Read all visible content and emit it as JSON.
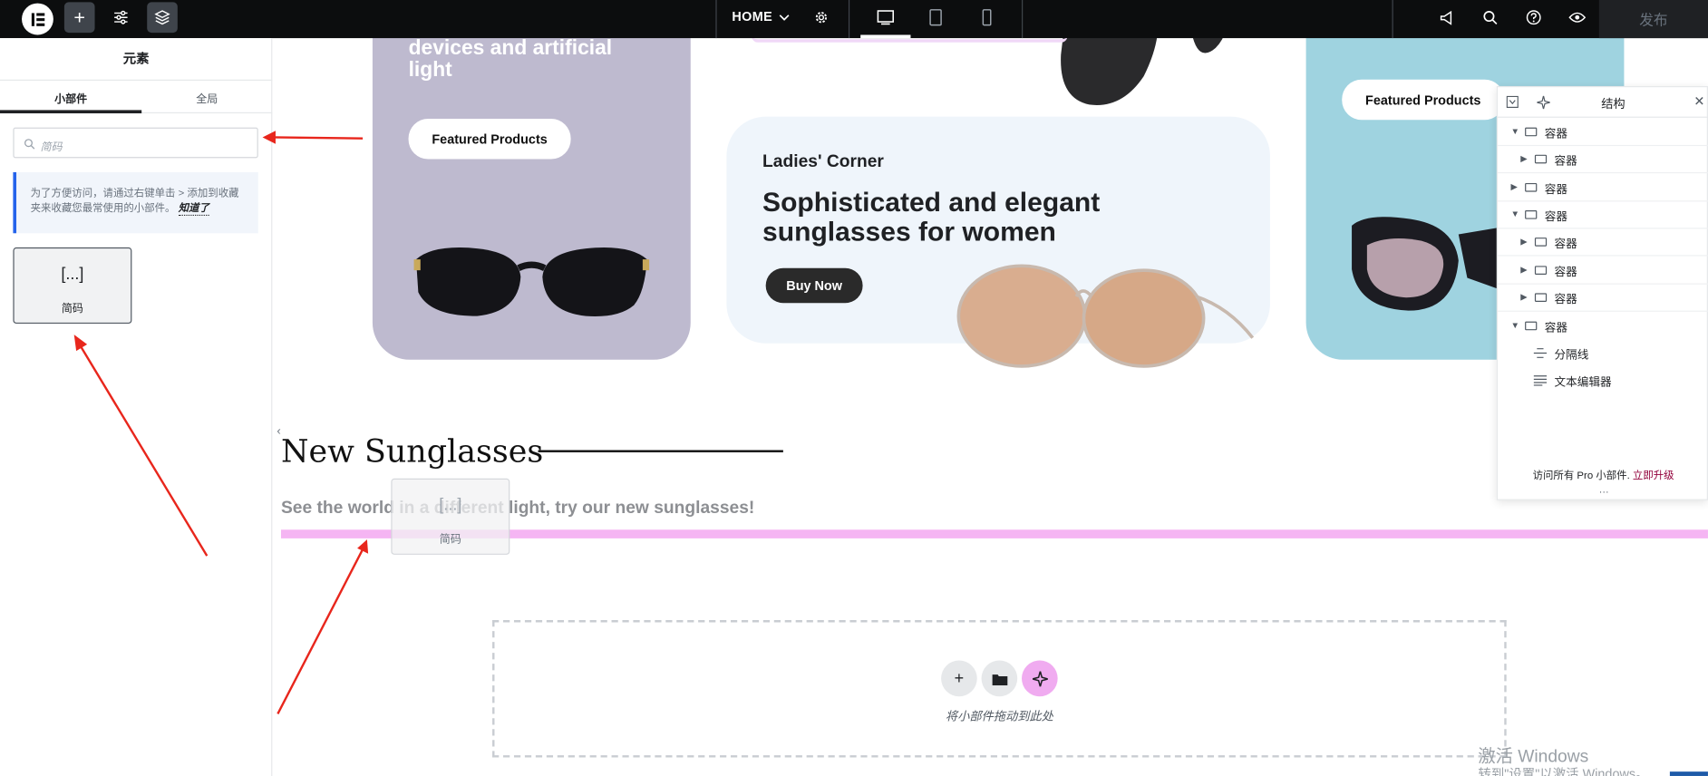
{
  "topbar": {
    "page_label": "HOME",
    "publish_label": "发布"
  },
  "panel": {
    "title": "元素",
    "tab_widgets": "小部件",
    "tab_global": "全局",
    "search_placeholder": "简码",
    "notice_text": "为了方便访问，请通过右键单击 > 添加到收藏夹来收藏您最常使用的小部件。",
    "notice_link": "知道了",
    "widget_icon": "[...]",
    "widget_label": "简码"
  },
  "canvas": {
    "card_left_text": "devices and artificial light",
    "card_left_button": "Featured Products",
    "card_mid_kicker": "Ladies' Corner",
    "card_mid_heading": "Sophisticated and elegant sunglasses for women",
    "card_mid_button": "Buy Now",
    "card_right_button": "Featured Products",
    "new_title": "New Sunglasses",
    "new_subtitle": "See the world in a different light, try our new sunglasses!",
    "ghost_icon": "[...]",
    "ghost_label": "简码",
    "dropzone_text": "将小部件拖动到此处"
  },
  "structure": {
    "title": "结构",
    "rows": [
      {
        "label": "容器"
      },
      {
        "label": "容器"
      },
      {
        "label": "容器"
      },
      {
        "label": "容器"
      },
      {
        "label": "容器"
      },
      {
        "label": "容器"
      },
      {
        "label": "容器"
      },
      {
        "label": "容器"
      },
      {
        "label": "分隔线"
      },
      {
        "label": "文本编辑器"
      }
    ],
    "footer_text": "访问所有 Pro 小部件.",
    "footer_link": "立即升级"
  },
  "watermark": {
    "line1": "激活 Windows",
    "line2": "转到\"设置\"以激活 Windows。"
  },
  "colors": {
    "accent_pink": "#f5b5f3",
    "arrow_red": "#e8261c",
    "upgrade": "#92003b"
  }
}
